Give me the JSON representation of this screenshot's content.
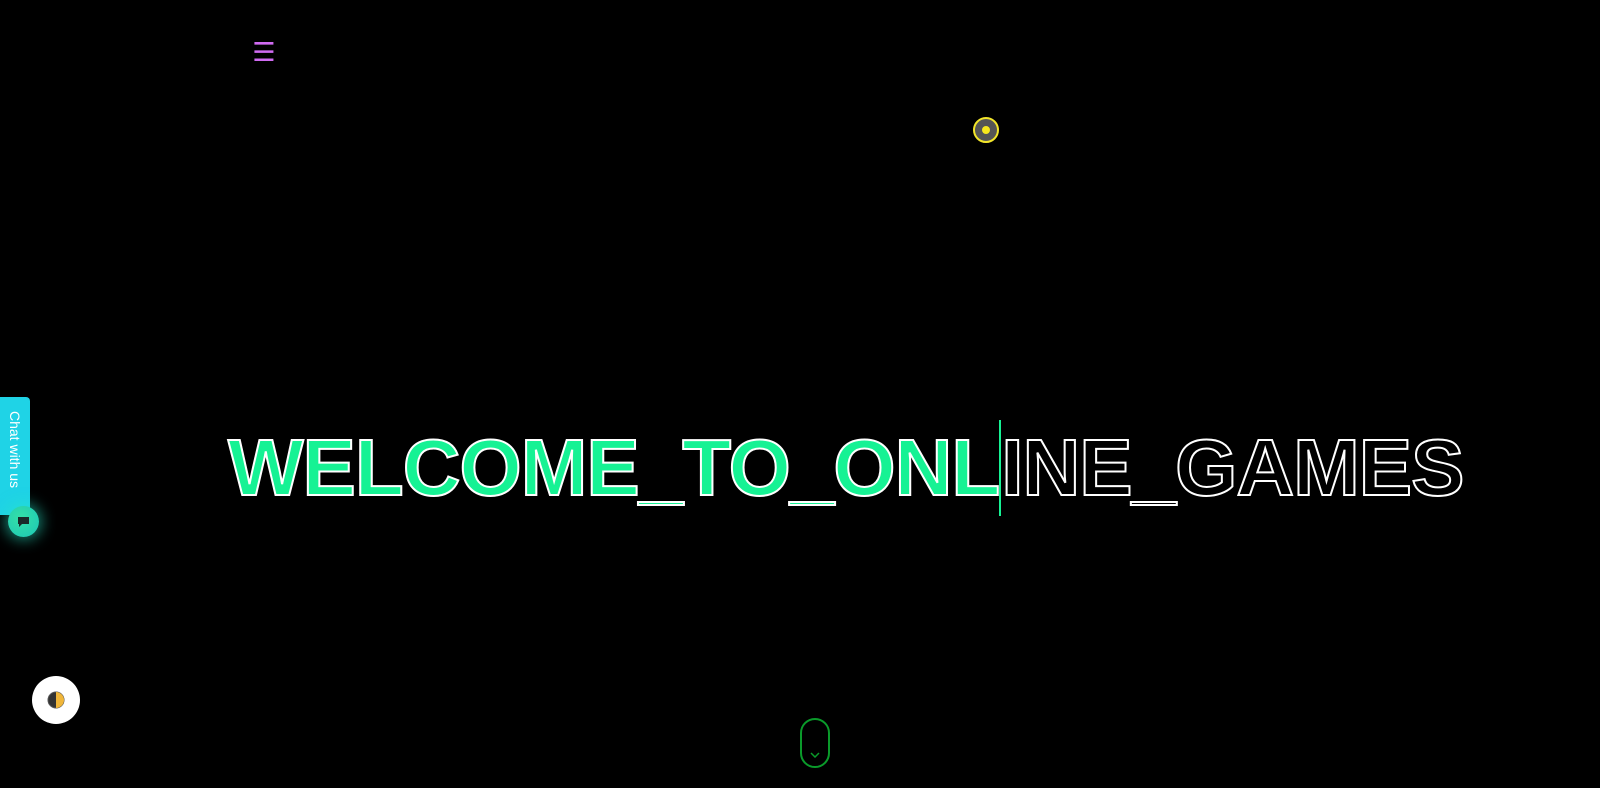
{
  "nav": {
    "menu_icon": "hamburger-icon",
    "menu_glyph": "☰",
    "menu_color": "#d06bf2"
  },
  "cursor": {
    "ring_color": "#f2e52a",
    "dot_color": "#f7e81d"
  },
  "hero": {
    "typed_text": "WELCOME_TO_ONL",
    "remaining_text": "INE_GAMES",
    "typed_color": "#16f294",
    "outline_color": "#ffffff"
  },
  "chat": {
    "tab_label": "Chat with us",
    "tab_color": "#1fd3e6",
    "bubble_icon": "chat-bubble-icon",
    "bubble_color": "#1cc7b6"
  },
  "theme_toggle": {
    "icon": "half-moon-icon"
  },
  "scroll": {
    "icon": "chevron-down-icon",
    "color": "#0a9a2a"
  }
}
